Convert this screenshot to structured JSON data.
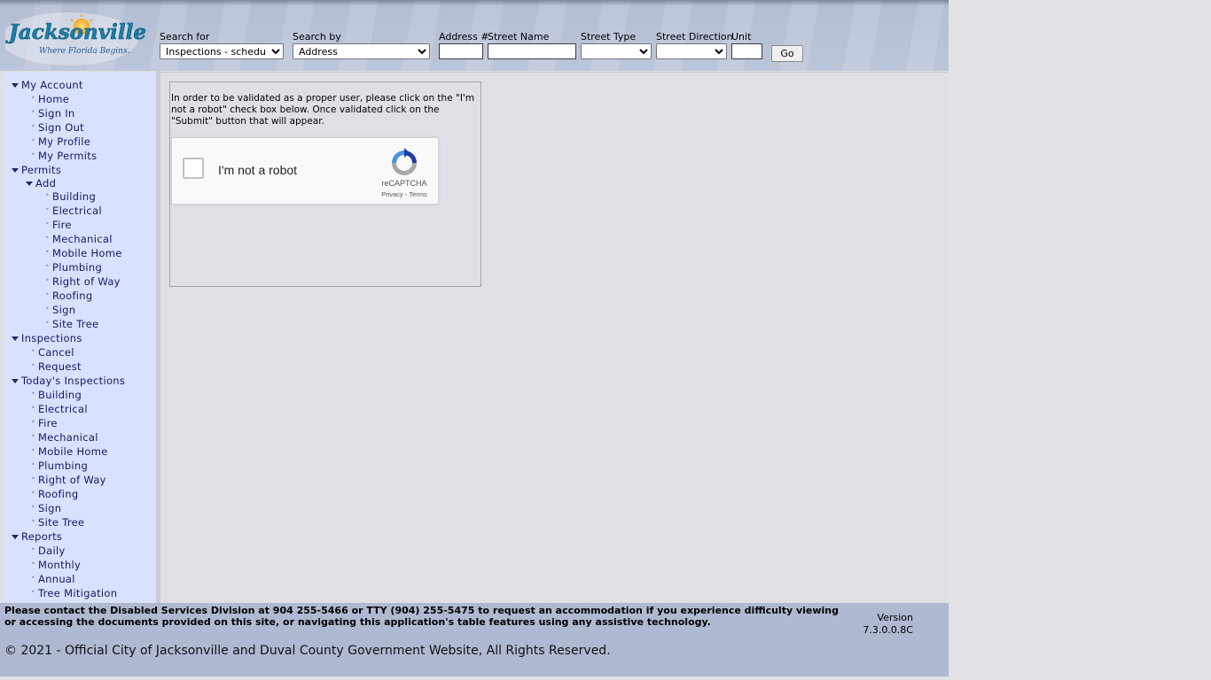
{
  "logo": {
    "name": "Jacksonville",
    "tagline": "Where Florida Begins."
  },
  "search": {
    "search_for_label": "Search for",
    "search_for_value": "Inspections - scheduled",
    "search_by_label": "Search by",
    "search_by_value": "Address",
    "address_label": "Address #",
    "street_name_label": "Street Name",
    "street_type_label": "Street Type",
    "street_direction_label": "Street Direction",
    "unit_label": "Unit",
    "go_label": "Go"
  },
  "sidebar": {
    "my_account": {
      "label": "My Account",
      "items": [
        "Home",
        "Sign In",
        "Sign Out",
        "My Profile",
        "My Permits"
      ]
    },
    "permits": {
      "label": "Permits",
      "add": {
        "label": "Add",
        "items": [
          "Building",
          "Electrical",
          "Fire",
          "Mechanical",
          "Mobile Home",
          "Plumbing",
          "Right of Way",
          "Roofing",
          "Sign",
          "Site Tree"
        ]
      }
    },
    "inspections": {
      "label": "Inspections",
      "items": [
        "Cancel",
        "Request"
      ]
    },
    "todays_inspections": {
      "label": "Today's Inspections",
      "items": [
        "Building",
        "Electrical",
        "Fire",
        "Mechanical",
        "Mobile Home",
        "Plumbing",
        "Right of Way",
        "Roofing",
        "Sign",
        "Site Tree"
      ]
    },
    "reports": {
      "label": "Reports",
      "items": [
        "Daily",
        "Monthly",
        "Annual",
        "Tree Mitigation"
      ]
    }
  },
  "main": {
    "instructions": "In order to be validated as a proper user, please click on the \"I'm not a robot\" check box below. Once validated click on the \"Submit\" button that will appear.",
    "recaptcha": {
      "label": "I'm not a robot",
      "brand": "reCAPTCHA",
      "privacy": "Privacy",
      "separator": " - ",
      "terms": "Terms"
    }
  },
  "footer": {
    "notice": "Please contact the Disabled Services Division at 904 255-5466 or TTY (904) 255-5475 to request an accommodation if you experience difficulty viewing or accessing the documents provided on this site, or navigating this application's table features using any assistive technology.",
    "version_label": "Version",
    "version_value": "7.3.0.0.8C",
    "copyright": "© 2021 - Official City of Jacksonville and Duval County Government Website, All Rights Reserved."
  },
  "colors": {
    "header_bg": "#b4bed4",
    "sidebar_bg": "#d8e1fd",
    "link": "#0f1b66",
    "footer_bg": "#b0b9d2"
  }
}
